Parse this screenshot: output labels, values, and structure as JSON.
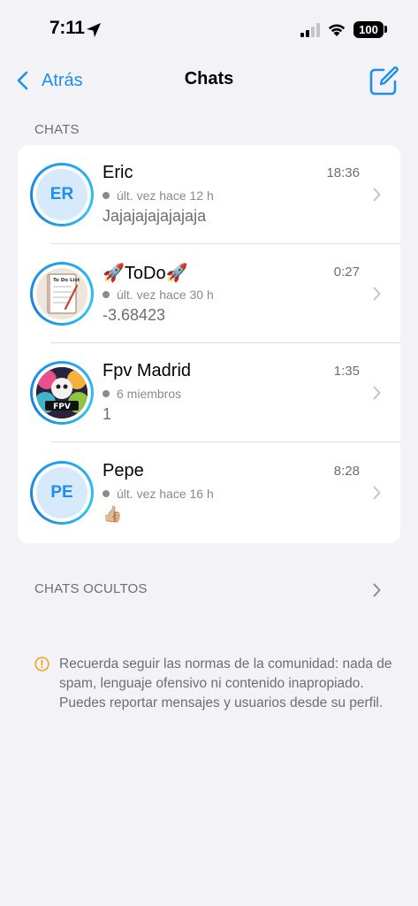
{
  "status_bar": {
    "time": "7:11",
    "battery": "100"
  },
  "navbar": {
    "back_label": "Atrás",
    "title": "Chats"
  },
  "chats_section": {
    "header": "CHATS",
    "items": [
      {
        "initials": "ER",
        "name": "Eric",
        "time": "18:36",
        "status": "últ. vez hace 12 h",
        "preview": "Jajajajajajajaja"
      },
      {
        "initials": "",
        "name": "🚀ToDo🚀",
        "time": "0:27",
        "status": "últ. vez hace 30 h",
        "preview": "-3.68423",
        "avatar_image": "to-do-list-notebook",
        "avatar_image_text": "To Do List"
      },
      {
        "initials": "",
        "name": "Fpv Madrid",
        "time": "1:35",
        "status": "6 miembros",
        "preview": "1",
        "avatar_image": "fpv-drone-colorful-logo",
        "avatar_image_text": "FPV"
      },
      {
        "initials": "PE",
        "name": "Pepe",
        "time": "8:28",
        "status": "últ. vez hace 16 h",
        "preview": "👍🏼"
      }
    ]
  },
  "hidden_chats": {
    "label": "CHATS OCULTOS"
  },
  "notice": {
    "text": "Recuerda seguir las normas de la comunidad: nada de spam, lenguaje ofensivo ni contenido inapropiado. Puedes reportar mensajes y usuarios desde su perfil."
  },
  "colors": {
    "accent": "#1f8ef1",
    "background": "#f2f2f7",
    "card": "#ffffff",
    "secondary_text": "#6d6d72",
    "warning": "#ff9500"
  },
  "icons": {
    "back": "chevron-left-icon",
    "compose": "compose-icon",
    "row_disclosure": "chevron-right-icon",
    "notice": "exclamation-circle-icon",
    "location": "location-arrow-icon",
    "signal": "cellular-signal-icon",
    "wifi": "wifi-icon",
    "battery": "battery-icon"
  }
}
